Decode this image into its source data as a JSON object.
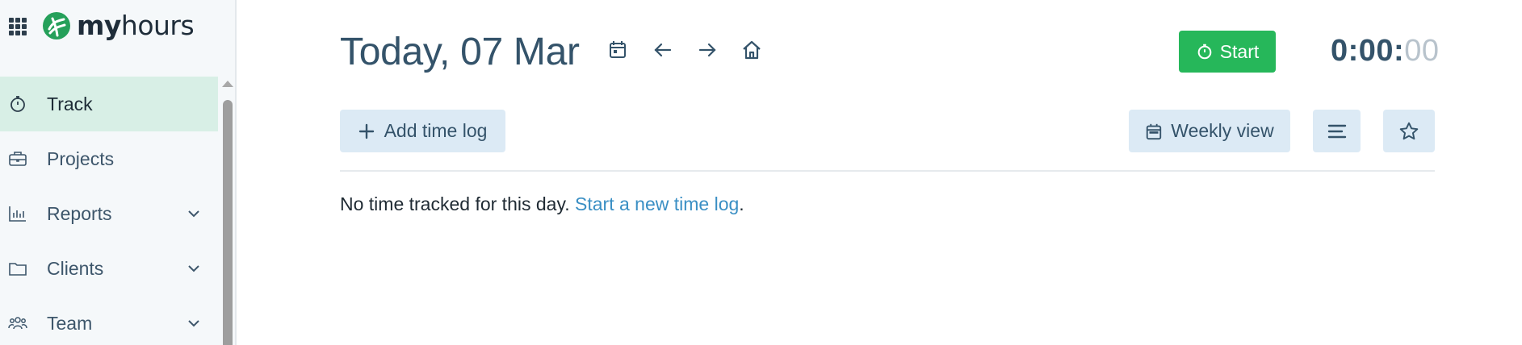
{
  "brand": {
    "logo_bold": "my",
    "logo_light": "hours"
  },
  "icons": {
    "apps": "apps-grid-icon",
    "logo": "myhours-logo-icon",
    "calendar": "calendar-icon",
    "prev": "arrow-left-icon",
    "next": "arrow-right-icon",
    "home": "home-icon",
    "stopwatch": "stopwatch-icon",
    "plus": "plus-icon",
    "list": "list-icon",
    "star": "star-icon"
  },
  "sidebar": {
    "items": [
      {
        "label": "Track",
        "icon": "stopwatch-icon",
        "active": true,
        "has_chevron": false
      },
      {
        "label": "Projects",
        "icon": "briefcase-icon",
        "active": false,
        "has_chevron": false
      },
      {
        "label": "Reports",
        "icon": "bar-chart-icon",
        "active": false,
        "has_chevron": true
      },
      {
        "label": "Clients",
        "icon": "folder-icon",
        "active": false,
        "has_chevron": true
      },
      {
        "label": "Team",
        "icon": "team-icon",
        "active": false,
        "has_chevron": true
      }
    ]
  },
  "header": {
    "title": "Today, 07 Mar",
    "start_label": "Start",
    "timer_main": "0:00:",
    "timer_seconds": "00"
  },
  "toolbar": {
    "add_label": "Add time log",
    "weekly_label": "Weekly view"
  },
  "content": {
    "empty_text": "No time tracked for this day.",
    "empty_link": "Start a new time log",
    "empty_end": "."
  },
  "colors": {
    "accent_green": "#26b75a",
    "active_nav_bg": "#d8efe6",
    "link_blue": "#3a8fc4",
    "button_light_bg": "#dceaf5",
    "title_color": "#34536a"
  }
}
